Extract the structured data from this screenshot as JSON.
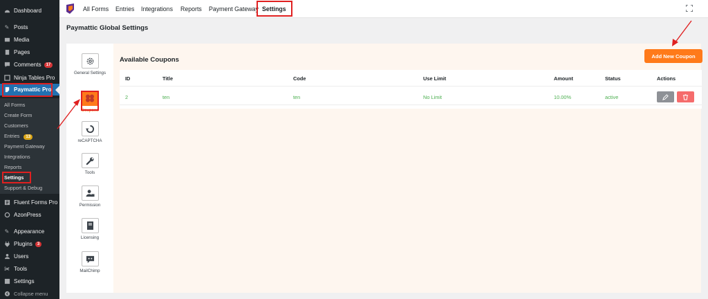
{
  "sidebar": {
    "items": [
      {
        "label": "Dashboard",
        "icon": "dashboard-icon"
      },
      {
        "label": "Posts",
        "icon": "pin-icon"
      },
      {
        "label": "Media",
        "icon": "media-icon"
      },
      {
        "label": "Pages",
        "icon": "pages-icon"
      },
      {
        "label": "Comments",
        "icon": "comments-icon",
        "badge": "17"
      },
      {
        "label": "Ninja Tables Pro",
        "icon": "table-icon"
      },
      {
        "label": "Paymattic Pro",
        "icon": "paymattic-icon"
      },
      {
        "label": "Fluent Forms Pro",
        "icon": "forms-icon"
      },
      {
        "label": "AzonPress",
        "icon": "azonpress-icon"
      },
      {
        "label": "Appearance",
        "icon": "brush-icon"
      },
      {
        "label": "Plugins",
        "icon": "plugin-icon",
        "badge": "3"
      },
      {
        "label": "Users",
        "icon": "users-icon"
      },
      {
        "label": "Tools",
        "icon": "wrench-icon"
      },
      {
        "label": "Settings",
        "icon": "settings-icon"
      },
      {
        "label": "Collapse menu",
        "icon": "collapse-icon"
      }
    ],
    "submenu": [
      {
        "label": "All Forms"
      },
      {
        "label": "Create Form"
      },
      {
        "label": "Customers"
      },
      {
        "label": "Entries",
        "badge": "13"
      },
      {
        "label": "Payment Gateway"
      },
      {
        "label": "Integrations"
      },
      {
        "label": "Reports"
      },
      {
        "label": "Settings"
      },
      {
        "label": "Support & Debug"
      }
    ]
  },
  "topnav": {
    "tabs": [
      "All Forms",
      "Entries",
      "Integrations",
      "Reports",
      "Payment Gateway",
      "Settings"
    ]
  },
  "page": {
    "title": "Paymattic Global Settings"
  },
  "settings_nav": [
    {
      "label": "General Settings",
      "icon": "gear-icon"
    },
    {
      "label": "Coupons",
      "icon": "coupon-icon"
    },
    {
      "label": "reCAPTCHA",
      "icon": "recaptcha-icon"
    },
    {
      "label": "Tools",
      "icon": "wrench-icon"
    },
    {
      "label": "Permission",
      "icon": "user-lock-icon"
    },
    {
      "label": "Licensing",
      "icon": "book-icon"
    },
    {
      "label": "MailChimp",
      "icon": "mailchimp-icon"
    }
  ],
  "coupons": {
    "title": "Available Coupons",
    "add_button": "Add New Coupon",
    "columns": [
      "ID",
      "Title",
      "Code",
      "Use Limit",
      "Amount",
      "Status",
      "Actions"
    ],
    "rows": [
      {
        "id": "2",
        "title": "ten",
        "code": "ten",
        "use_limit": "No Limit",
        "amount": "10.00%",
        "status": "active"
      }
    ]
  },
  "colors": {
    "accent": "#ff7a1a",
    "wp_sidebar": "#1d2327",
    "wp_active": "#2271b1",
    "highlight_box": "#e02020",
    "row_text": "#4caf50",
    "delete": "#f56c6c"
  }
}
